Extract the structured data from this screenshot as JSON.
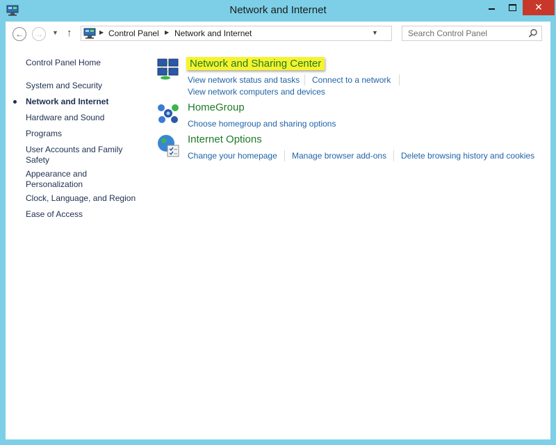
{
  "window": {
    "title": "Network and Internet",
    "colors": {
      "frame": "#7ccfe6",
      "close": "#c7382b",
      "link": "#1f63a6",
      "category_title": "#1e7a2a",
      "highlight": "#f6f32e"
    }
  },
  "toolbar": {
    "back_icon": "back-arrow-icon",
    "forward_icon": "forward-arrow-icon",
    "up_icon": "up-arrow-icon",
    "breadcrumb": [
      "Control Panel",
      "Network and Internet"
    ],
    "search": {
      "placeholder": "Search Control Panel",
      "value": ""
    }
  },
  "sidebar": {
    "home_label": "Control Panel Home",
    "items": [
      {
        "label": "System and Security"
      },
      {
        "label": "Network and Internet",
        "current": true
      },
      {
        "label": "Hardware and Sound"
      },
      {
        "label": "Programs"
      },
      {
        "label": "User Accounts and Family Safety"
      },
      {
        "label": "Appearance and Personalization"
      },
      {
        "label": "Clock, Language, and Region"
      },
      {
        "label": "Ease of Access"
      }
    ]
  },
  "categories": [
    {
      "title": "Network and Sharing Center",
      "icon": "network-sharing-icon",
      "links": [
        "View network status and tasks",
        "Connect to a network",
        "View network computers and devices"
      ]
    },
    {
      "title": "HomeGroup",
      "icon": "homegroup-icon",
      "links": [
        "Choose homegroup and sharing options"
      ]
    },
    {
      "title": "Internet Options",
      "icon": "internet-options-icon",
      "links": [
        "Change your homepage",
        "Manage browser add-ons",
        "Delete browsing history and cookies"
      ]
    }
  ]
}
